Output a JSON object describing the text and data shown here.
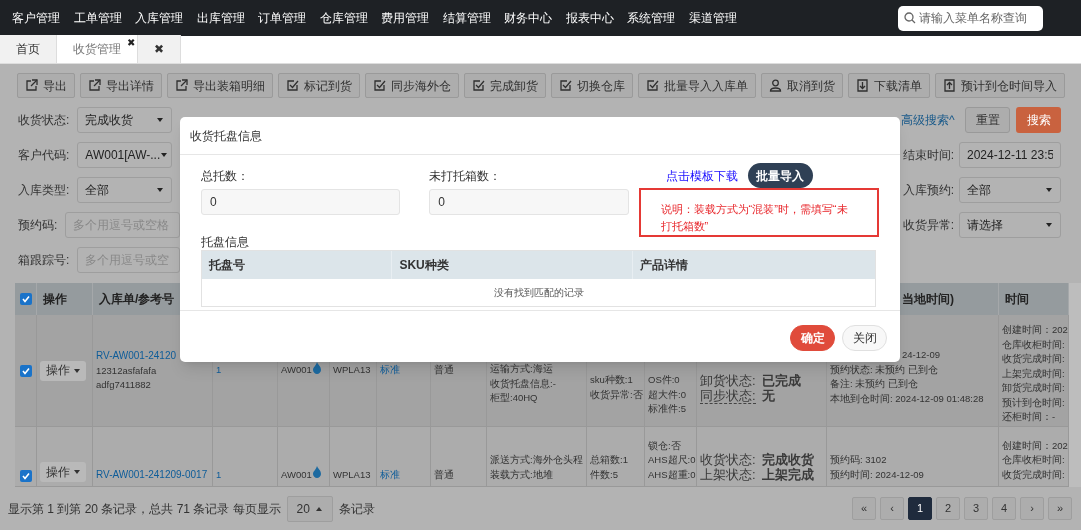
{
  "nav": {
    "items": [
      "客户管理",
      "工单管理",
      "入库管理",
      "出库管理",
      "订单管理",
      "仓库管理",
      "费用管理",
      "结算管理",
      "财务中心",
      "报表中心",
      "系统管理",
      "渠道管理"
    ],
    "search": {
      "placeholder": "请输入菜单名称查询"
    }
  },
  "tabs": [
    {
      "label": "首页",
      "selected": false
    },
    {
      "label": "收货管理",
      "selected": true,
      "close": "✖"
    },
    {
      "label": "✖",
      "selected": false
    }
  ],
  "toolbar": [
    {
      "label": "导出",
      "kind": "export"
    },
    {
      "label": "导出详情",
      "kind": "export"
    },
    {
      "label": "导出装箱明细",
      "kind": "export"
    },
    {
      "label": "标记到货",
      "kind": "check"
    },
    {
      "label": "同步海外仓",
      "kind": "check"
    },
    {
      "label": "完成卸货",
      "kind": "check"
    },
    {
      "label": "切换仓库",
      "kind": "check"
    },
    {
      "label": "批量导入入库单",
      "kind": "check"
    },
    {
      "label": "取消到货",
      "kind": "user"
    },
    {
      "label": "下载清单",
      "kind": "download"
    },
    {
      "label": "预计到仓时间导入",
      "kind": "upload"
    }
  ],
  "filters": {
    "left": [
      {
        "label": "收货状态:",
        "kind": "select",
        "value": "完成收货"
      },
      {
        "label": "客户代码:",
        "kind": "select",
        "value": "AW001[AW-..."
      },
      {
        "label": "入库类型:",
        "kind": "select",
        "value": "全部"
      },
      {
        "label": "预约码:",
        "kind": "input",
        "placeholder": "多个用逗号或空格"
      },
      {
        "label": "箱跟踪号:",
        "kind": "input",
        "placeholder": "多个用逗号或空"
      }
    ],
    "right": [
      {
        "label": "结束时间:",
        "kind": "input",
        "value": "2024-12-11 23:5"
      },
      {
        "label": "入库预约:",
        "kind": "select",
        "value": "全部"
      },
      {
        "label": "收货异常:",
        "kind": "select",
        "value": "请选择"
      }
    ],
    "advanced": "高级搜索^",
    "reset": "重置",
    "search": "搜索"
  },
  "table": {
    "all_checked": true,
    "headers": [
      "操作",
      "入库单/参考号",
      "当地时间)",
      "时间"
    ],
    "rows": [
      {
        "checked": true,
        "action": "操作",
        "cells": [
          {
            "kind": "ref",
            "link": "RV-AW001-24120",
            "lines": [
              "12312asfafafa",
              "adfg7411882"
            ]
          },
          {
            "kind": "link",
            "text": "1"
          },
          {
            "kind": "customer",
            "text": "AW001"
          },
          {
            "kind": "text",
            "text": "WPLA13"
          },
          {
            "kind": "link",
            "text": "标准"
          },
          {
            "kind": "text",
            "text": "普通"
          },
          {
            "kind": "lines",
            "lines": [
              "运输方式:海运",
              "收货托盘信息:-",
              "柜型:40HQ"
            ]
          },
          {
            "kind": "lines",
            "lines": [
              "sku种数:1",
              "收货异常:否"
            ]
          },
          {
            "kind": "lines",
            "lines": [
              "OS件:0",
              "超大件:0",
              "标准件:5"
            ]
          },
          {
            "kind": "status",
            "lines": [
              {
                "label": "卸货状态:",
                "value": "已完成",
                "hint": false
              },
              {
                "label": "同步状态:",
                "value": "无",
                "hint": true
              }
            ]
          },
          {
            "kind": "lines",
            "lines": [
              "24-12-09",
              "预约状态: 未预约 已到仓",
              "备注: 未预约 已到仓",
              "本地到仓时间: 2024-12-09 01:48:28"
            ]
          },
          {
            "kind": "times",
            "lines": [
              "创建时间：202",
              "仓库收柜时间:",
              "收货完成时间:",
              "上架完成时间:",
              "卸货完成时间:",
              "预计到仓时间:",
              "还柜时间：-"
            ]
          }
        ]
      },
      {
        "checked": true,
        "action": "操作",
        "cells": [
          {
            "kind": "ref",
            "link": "RV-AW001-241209-0017"
          },
          {
            "kind": "link",
            "text": "1"
          },
          {
            "kind": "customer",
            "text": "AW001"
          },
          {
            "kind": "text",
            "text": "WPLA13"
          },
          {
            "kind": "link",
            "text": "标准"
          },
          {
            "kind": "text",
            "text": "普通"
          },
          {
            "kind": "lines",
            "lines": [
              "派送方式:海外仓头程",
              "装载方式:地堆"
            ]
          },
          {
            "kind": "lines",
            "lines": [
              "总箱数:1",
              "件数:5"
            ]
          },
          {
            "kind": "lines",
            "lines": [
              "锁仓:否",
              "AHS超尺:0",
              "AHS超重:0"
            ]
          },
          {
            "kind": "status",
            "lines": [
              {
                "label": "收货状态:",
                "value": "完成收货",
                "hint": false
              },
              {
                "label": "上架状态:",
                "value": "上架完成",
                "hint": false
              }
            ]
          },
          {
            "kind": "lines",
            "lines": [
              "预约码: 3102",
              "预约时间: 2024-12-09"
            ]
          },
          {
            "kind": "times",
            "lines": [
              "创建时间：202",
              "仓库收柜时间:",
              "收货完成时间:"
            ]
          }
        ]
      }
    ]
  },
  "footer": {
    "summary": "显示第 1 到第 20 条记录，总共 71 条记录 每页显示",
    "page_size": "20",
    "suffix": "条记录",
    "pages": [
      {
        "label": "«",
        "selected": false
      },
      {
        "label": "‹",
        "selected": false
      },
      {
        "label": "1",
        "selected": true
      },
      {
        "label": "2",
        "selected": false
      },
      {
        "label": "3",
        "selected": false
      },
      {
        "label": "4",
        "selected": false
      },
      {
        "label": "›",
        "selected": false
      },
      {
        "label": "»",
        "selected": false
      }
    ]
  },
  "dialog": {
    "title": "收货托盘信息",
    "fields": [
      {
        "label": "总托数：",
        "value": "0"
      },
      {
        "label": "未打托箱数：",
        "value": "0"
      }
    ],
    "template_link": "点击模板下载",
    "import_button": "批量导入",
    "note": "说明：装载方式为“混装”时，需填写“未打托箱数”",
    "section_label": "托盘信息",
    "table": {
      "columns": [
        "托盘号",
        "SKU种类",
        "产品详情"
      ],
      "empty": "没有找到匹配的记录"
    },
    "buttons": [
      {
        "label": "确定",
        "kind": "primary"
      },
      {
        "label": "关闭",
        "kind": "default"
      }
    ]
  }
}
